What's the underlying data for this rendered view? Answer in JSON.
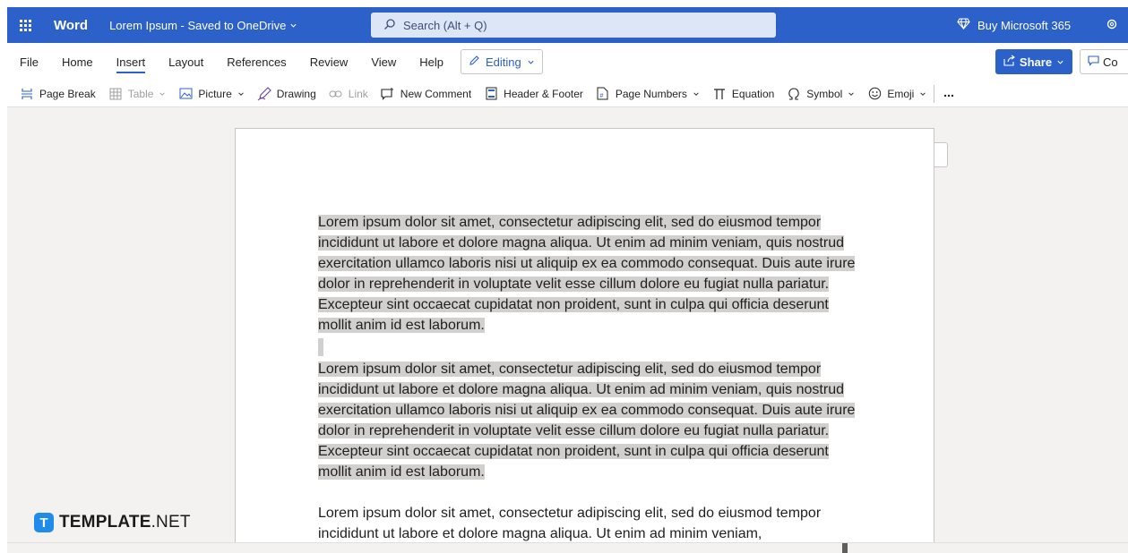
{
  "titlebar": {
    "app_name": "Word",
    "doc_title": "Lorem Ipsum - Saved to OneDrive",
    "search_placeholder": "Search (Alt + Q)",
    "buy_label": "Buy Microsoft 365"
  },
  "menu": {
    "tabs": [
      {
        "label": "File"
      },
      {
        "label": "Home"
      },
      {
        "label": "Insert",
        "active": true
      },
      {
        "label": "Layout"
      },
      {
        "label": "References"
      },
      {
        "label": "Review"
      },
      {
        "label": "View"
      },
      {
        "label": "Help"
      }
    ],
    "editing_label": "Editing",
    "share_label": "Share",
    "comments_label": "Co"
  },
  "ribbon": {
    "items": [
      {
        "label": "Page Break",
        "icon": "page-break-icon"
      },
      {
        "label": "Table",
        "icon": "table-icon",
        "disabled": true,
        "dropdown": true
      },
      {
        "label": "Picture",
        "icon": "picture-icon",
        "dropdown": true
      },
      {
        "label": "Drawing",
        "icon": "drawing-icon"
      },
      {
        "label": "Link",
        "icon": "link-icon",
        "disabled": true
      },
      {
        "label": "New Comment",
        "icon": "comment-icon"
      },
      {
        "label": "Header & Footer",
        "icon": "header-footer-icon"
      },
      {
        "label": "Page Numbers",
        "icon": "page-numbers-icon",
        "dropdown": true
      },
      {
        "label": "Equation",
        "icon": "equation-icon"
      },
      {
        "label": "Symbol",
        "icon": "omega-icon",
        "dropdown": true
      },
      {
        "label": "Emoji",
        "icon": "emoji-icon",
        "dropdown": true
      }
    ]
  },
  "document": {
    "paragraphs": [
      {
        "text": "Lorem ipsum dolor sit amet, consectetur adipiscing elit, sed do eiusmod tempor incididunt ut labore et dolore magna aliqua. Ut enim ad minim veniam, quis nostrud exercitation ullamco laboris nisi ut aliquip ex ea commodo consequat. Duis aute irure dolor in reprehenderit in voluptate velit esse cillum dolore eu fugiat nulla pariatur. Excepteur sint occaecat cupidatat non proident, sunt in culpa qui officia deserunt mollit anim id est laborum.",
        "selected": true
      },
      {
        "text": "Lorem ipsum dolor sit amet, consectetur adipiscing elit, sed do eiusmod tempor incididunt ut labore et dolore magna aliqua. Ut enim ad minim veniam, quis nostrud exercitation ullamco laboris nisi ut aliquip ex ea commodo consequat. Duis aute irure dolor in reprehenderit in voluptate velit esse cillum dolore eu fugiat nulla pariatur. Excepteur sint occaecat cupidatat non proident, sunt in culpa qui officia deserunt mollit anim id est laborum.",
        "selected": true
      },
      {
        "text": "Lorem ipsum dolor sit amet, consectetur adipiscing elit, sed do eiusmod tempor incididunt ut labore et dolore magna aliqua. Ut enim ad minim veniam,",
        "selected": false
      }
    ]
  },
  "watermark": {
    "brand": "TEMPLATE",
    "suffix": ".NET",
    "mark": "T"
  },
  "colors": {
    "accent": "#2b61c8",
    "selection": "#d2d0ce"
  }
}
